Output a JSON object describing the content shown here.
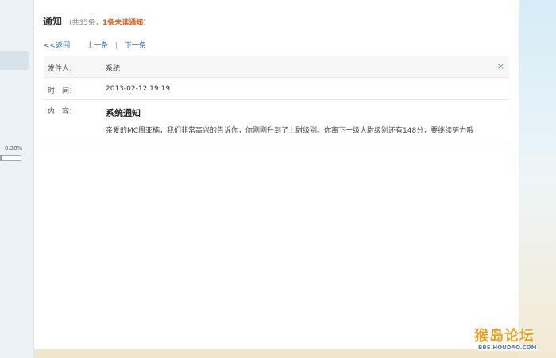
{
  "header": {
    "title": "通知",
    "count_prefix": "(共35条，",
    "unread": "1条未读通知",
    "count_suffix": ")"
  },
  "nav": {
    "back": "<<返回",
    "prev": "上一条",
    "separator": "|",
    "next": "下一条"
  },
  "detail": {
    "sender_label": "发件人：",
    "sender_value": "系统",
    "time_label": "时　间：",
    "time_value": "2013-02-12 19:19",
    "content_label": "内　容：",
    "content_title": "系统通知",
    "content_body": "亲爱的MC周亚楠，我们非常高兴的告诉你，你刚刚升到了上尉级别。你离下一级大尉级别还有148分，要继续努力哦",
    "close": "×"
  },
  "sidebar": {
    "progress_text": "0.38%",
    "progress_value": 0.0038
  },
  "watermark": {
    "main": "猴岛论坛",
    "sub": "BBS.HOUDAO.COM"
  },
  "colors": {
    "link": "#2b6cb0",
    "unread": "#e45c1c",
    "watermark": "#f2a020"
  }
}
